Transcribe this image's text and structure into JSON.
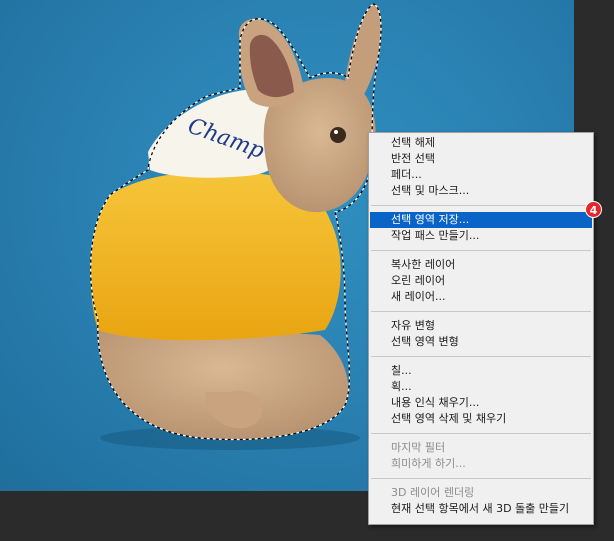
{
  "context_menu": {
    "groups": [
      {
        "items": [
          {
            "label": "선택 해제"
          },
          {
            "label": "반전 선택"
          },
          {
            "label": "페더..."
          },
          {
            "label": "선택 및 마스크..."
          }
        ]
      },
      {
        "items": [
          {
            "label": "선택 영역 저장...",
            "highlighted": true
          },
          {
            "label": "작업 패스 만들기..."
          }
        ]
      },
      {
        "items": [
          {
            "label": "복사한 레이어"
          },
          {
            "label": "오린 레이어"
          },
          {
            "label": "새 레이어..."
          }
        ]
      },
      {
        "items": [
          {
            "label": "자유 변형"
          },
          {
            "label": "선택 영역 변형"
          }
        ]
      },
      {
        "items": [
          {
            "label": "칠..."
          },
          {
            "label": "획..."
          },
          {
            "label": "내용 인식 채우기..."
          },
          {
            "label": "선택 영역 삭제 및 채우기"
          }
        ]
      },
      {
        "items": [
          {
            "label": "마지막 필터",
            "disabled": true
          },
          {
            "label": "희미하게 하기...",
            "disabled": true
          }
        ]
      },
      {
        "items": [
          {
            "label": "3D 레이어 렌더링",
            "disabled": true
          },
          {
            "label": "현재 선택 항목에서 새 3D 돌출 만들기"
          }
        ]
      }
    ]
  },
  "step_badge": {
    "label": "4"
  },
  "colors": {
    "highlight": "#0a64c8",
    "badge": "#e8242b",
    "photo_background": "#2a82b3",
    "hoodie": "#f2b31d"
  }
}
